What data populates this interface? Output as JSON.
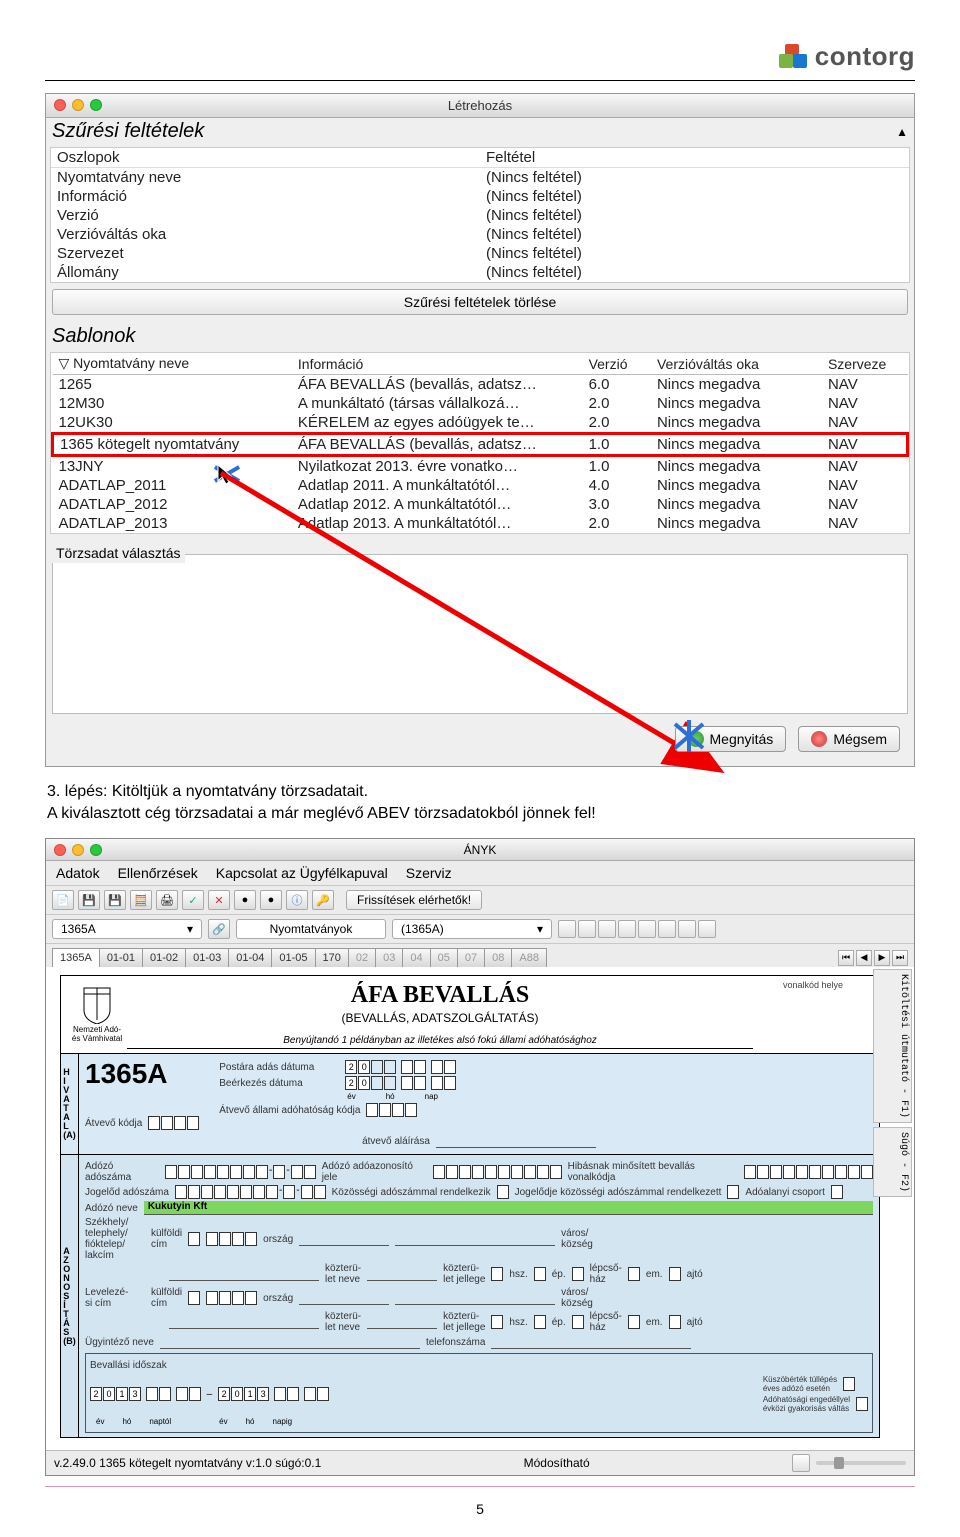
{
  "logo_text": "contorg",
  "dialog1": {
    "title": "Létrehozás",
    "filter_section": "Szűrési feltételek",
    "filter_table": {
      "headers": [
        "Oszlopok",
        "Feltétel"
      ],
      "rows": [
        [
          "Nyomtatvány neve",
          "(Nincs feltétel)"
        ],
        [
          "Információ",
          "(Nincs feltétel)"
        ],
        [
          "Verzió",
          "(Nincs feltétel)"
        ],
        [
          "Verzióváltás oka",
          "(Nincs feltétel)"
        ],
        [
          "Szervezet",
          "(Nincs feltétel)"
        ],
        [
          "Állomány",
          "(Nincs feltétel)"
        ]
      ]
    },
    "clear_filters": "Szűrési feltételek törlése",
    "templates_section": "Sablonok",
    "templates_headers": [
      "▽ Nyomtatvány neve",
      "Információ",
      "Verzió",
      "Verzióváltás oka",
      "Szerveze"
    ],
    "templates_rows": [
      [
        "1265",
        "ÁFA BEVALLÁS (bevallás, adatsz…",
        "6.0",
        "Nincs megadva",
        "NAV"
      ],
      [
        "12M30",
        "A munkáltató (társas vállalkozá…",
        "2.0",
        "Nincs megadva",
        "NAV"
      ],
      [
        "12UK30",
        "KÉRELEM az egyes adóügyek te…",
        "2.0",
        "Nincs megadva",
        "NAV"
      ],
      [
        "1365 kötegelt nyomtatvány",
        "ÁFA BEVALLÁS (bevallás, adatsz…",
        "1.0",
        "Nincs megadva",
        "NAV"
      ],
      [
        "13JNY",
        "Nyilatkozat 2013. évre vonatko…",
        "1.0",
        "Nincs megadva",
        "NAV"
      ],
      [
        "ADATLAP_2011",
        "Adatlap 2011. A munkáltatótól…",
        "4.0",
        "Nincs megadva",
        "NAV"
      ],
      [
        "ADATLAP_2012",
        "Adatlap 2012. A munkáltatótól…",
        "3.0",
        "Nincs megadva",
        "NAV"
      ],
      [
        "ADATLAP_2013",
        "Adatlap 2013. A munkáltatótól…",
        "2.0",
        "Nincs megadva",
        "NAV"
      ]
    ],
    "torzs_label": "Törzsadat választás",
    "open_btn": "Megnyitás",
    "cancel_btn": "Mégsem"
  },
  "step_text_1": "3. lépés: Kitöltjük a nyomtatvány törzsadatait.",
  "step_text_2": "A kiválasztott cég törzsadatai a már meglévő ABEV törzsadatokból jönnek fel!",
  "anyk": {
    "title": "ÁNYK",
    "menu": [
      "Adatok",
      "Ellenőrzések",
      "Kapcsolat az Ügyfélkapuval",
      "Szerviz"
    ],
    "updates": "Frissítések elérhetők!",
    "left_code": "1365A",
    "mid_label": "Nyomtatványok",
    "mid_val": "(1365A)",
    "tabs": [
      "1365A",
      "01-01",
      "01-02",
      "01-03",
      "01-04",
      "01-05",
      "170",
      "02",
      "03",
      "04",
      "05",
      "07",
      "08",
      "A88"
    ],
    "form_title": "ÁFA BEVALLÁS",
    "form_sub": "(BEVALLÁS, ADATSZOLGÁLTATÁS)",
    "crest_txt1": "Nemzeti Adó-",
    "crest_txt2": "és Vámhivatal",
    "form_note": "Benyújtandó 1 példányban az illetékes alsó fokú állami adóhatósághoz",
    "barcode": "vonalkód helye",
    "code": "1365A",
    "date1": "Postára adás dátuma",
    "date2": "Beérkezés dátuma",
    "date_hdr": [
      "év",
      "hó",
      "nap"
    ],
    "atvevo": "Átvevő kódja",
    "atvevo2": "Átvevő állami adóhatóság kódja",
    "atvevo3": "átvevő aláírása",
    "adozo_szam": "Adózó adószáma",
    "adozo_jel": "Adózó adóazonosító jele",
    "hibas": "Hibásnak minősített bevallás vonalkódja",
    "jogelod": "Jogelőd adószáma",
    "koz_rend": "Közösségi adószámmal rendelkezik",
    "jogelod_koz": "Jogelődje közösségi adószámmal rendelkezett",
    "csoport": "Adóalanyi csoport",
    "adozo_neve_lbl": "Adózó neve",
    "adozo_neve_val": "Kukutyin Kft",
    "szekhely": "Székhely/​telephely/​fióktelep/​lakcím",
    "kulfoldi": "külföldi\ncím",
    "levelezesi": "Levelezé-\nsi cím",
    "orszag": "ország",
    "kozterulet": "közterü-\nlet neve",
    "kozjelleg": "közterü-\nlet jellege",
    "hsz": "hsz.",
    "ep": "ép.",
    "lepcso": "lépcső-\nház",
    "em": "em.",
    "ajto": "ajtó",
    "varos": "város/\nközség",
    "ugy": "Ügyintéző neve",
    "tel": "telefonszáma",
    "idoszak": "Bevallási időszak",
    "kuszob": "Küszöbérték túllépés\néves adózó esetén",
    "adohat": "Adóhatósági engedéllyel\névközi gyakorisás váltás",
    "naptol": "naptól",
    "napig": "napig",
    "side1": "Kitöltési útmutató - F1)",
    "side2": "Súgó - F2)",
    "status_left": "v.2.49.0   1365 kötegelt nyomtatvány v:1.0 súgó:0.1",
    "status_right": "Módosítható"
  },
  "page_num": "5"
}
